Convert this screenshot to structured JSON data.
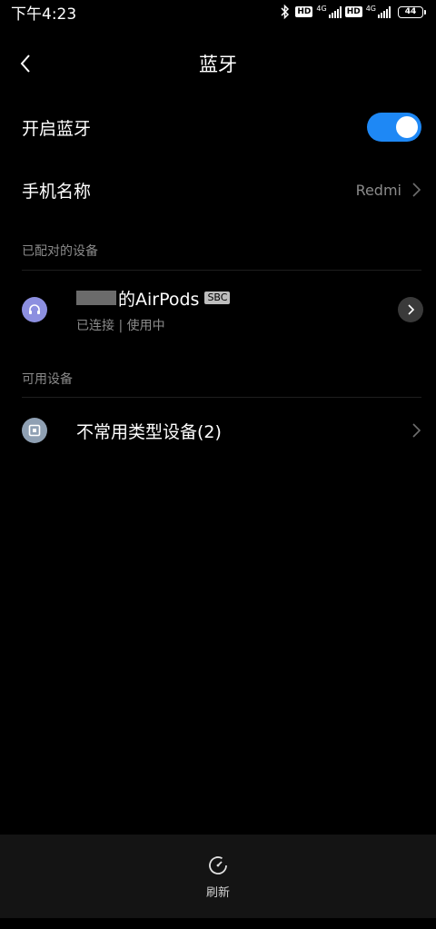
{
  "status_bar": {
    "time": "下午4:23",
    "hd_badge_1": "HD",
    "net_1": "4G",
    "hd_badge_2": "HD",
    "net_2": "4G",
    "battery": "44"
  },
  "header": {
    "title": "蓝牙"
  },
  "bluetooth_toggle": {
    "label": "开启蓝牙",
    "enabled": true,
    "accent_color": "#1e88f5"
  },
  "phone_name": {
    "label": "手机名称",
    "value": "Redmi"
  },
  "paired_section": {
    "title": "已配对的设备",
    "devices": [
      {
        "name": "的AirPods",
        "codec": "SBC",
        "status": "已连接 | 使用中",
        "icon": "headset-icon"
      }
    ]
  },
  "available_section": {
    "title": "可用设备",
    "devices": [
      {
        "name": "不常用类型设备(2)",
        "icon": "device-icon"
      }
    ]
  },
  "bottom_bar": {
    "refresh_label": "刷新"
  }
}
